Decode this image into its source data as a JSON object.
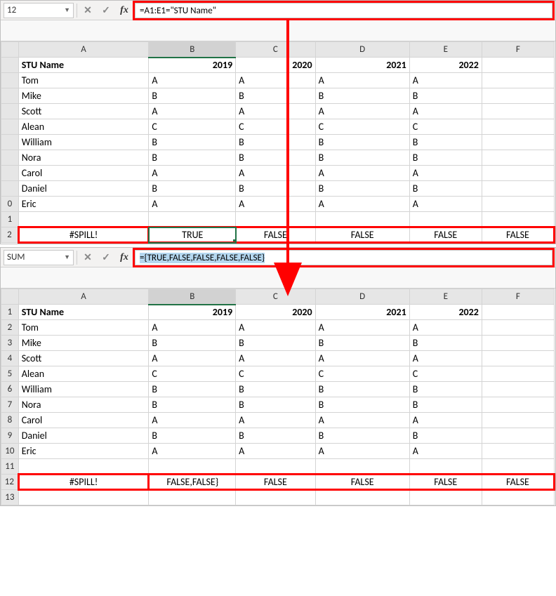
{
  "panel1": {
    "namebox": "12",
    "formula": "=A1:E1=\"STU Name\"",
    "headers": [
      "A",
      "B",
      "C",
      "D",
      "E",
      "F"
    ],
    "rows": [
      {
        "n": "",
        "cells": [
          "STU Name",
          "2019",
          "2020",
          "2021",
          "2022",
          ""
        ]
      },
      {
        "n": "",
        "cells": [
          "Tom",
          "A",
          "A",
          "A",
          "A",
          ""
        ]
      },
      {
        "n": "",
        "cells": [
          "Mike",
          "B",
          "B",
          "B",
          "B",
          ""
        ]
      },
      {
        "n": "",
        "cells": [
          "Scott",
          "A",
          "A",
          "A",
          "A",
          ""
        ]
      },
      {
        "n": "",
        "cells": [
          "Alean",
          "C",
          "C",
          "C",
          "C",
          ""
        ]
      },
      {
        "n": "",
        "cells": [
          "William",
          "B",
          "B",
          "B",
          "B",
          ""
        ]
      },
      {
        "n": "",
        "cells": [
          "Nora",
          "B",
          "B",
          "B",
          "B",
          ""
        ]
      },
      {
        "n": "",
        "cells": [
          "Carol",
          "A",
          "A",
          "A",
          "A",
          ""
        ]
      },
      {
        "n": "",
        "cells": [
          "Daniel",
          "B",
          "B",
          "B",
          "B",
          ""
        ]
      },
      {
        "n": "0",
        "cells": [
          "Eric",
          "A",
          "A",
          "A",
          "A",
          ""
        ]
      },
      {
        "n": "1",
        "cells": [
          "",
          "",
          "",
          "",
          "",
          ""
        ]
      },
      {
        "n": "2",
        "cells": [
          "#SPILL!",
          "TRUE",
          "FALSE",
          "FALSE",
          "FALSE",
          "FALSE"
        ]
      }
    ]
  },
  "panel2": {
    "namebox": "SUM",
    "formula": "={TRUE,FALSE,FALSE,FALSE,FALSE}",
    "headers": [
      "A",
      "B",
      "C",
      "D",
      "E",
      "F"
    ],
    "rows": [
      {
        "n": "1",
        "cells": [
          "STU Name",
          "2019",
          "2020",
          "2021",
          "2022",
          ""
        ]
      },
      {
        "n": "2",
        "cells": [
          "Tom",
          "A",
          "A",
          "A",
          "A",
          ""
        ]
      },
      {
        "n": "3",
        "cells": [
          "Mike",
          "B",
          "B",
          "B",
          "B",
          ""
        ]
      },
      {
        "n": "4",
        "cells": [
          "Scott",
          "A",
          "A",
          "A",
          "A",
          ""
        ]
      },
      {
        "n": "5",
        "cells": [
          "Alean",
          "C",
          "C",
          "C",
          "C",
          ""
        ]
      },
      {
        "n": "6",
        "cells": [
          "William",
          "B",
          "B",
          "B",
          "B",
          ""
        ]
      },
      {
        "n": "7",
        "cells": [
          "Nora",
          "B",
          "B",
          "B",
          "B",
          ""
        ]
      },
      {
        "n": "8",
        "cells": [
          "Carol",
          "A",
          "A",
          "A",
          "A",
          ""
        ]
      },
      {
        "n": "9",
        "cells": [
          "Daniel",
          "B",
          "B",
          "B",
          "B",
          ""
        ]
      },
      {
        "n": "10",
        "cells": [
          "Eric",
          "A",
          "A",
          "A",
          "A",
          ""
        ]
      },
      {
        "n": "11",
        "cells": [
          "",
          "",
          "",
          "",
          "",
          ""
        ]
      },
      {
        "n": "12",
        "cells": [
          "#SPILL!",
          "FALSE,FALSE}",
          "FALSE",
          "FALSE",
          "FALSE",
          "FALSE"
        ]
      },
      {
        "n": "13",
        "cells": [
          "",
          "",
          "",
          "",
          "",
          ""
        ]
      }
    ]
  }
}
